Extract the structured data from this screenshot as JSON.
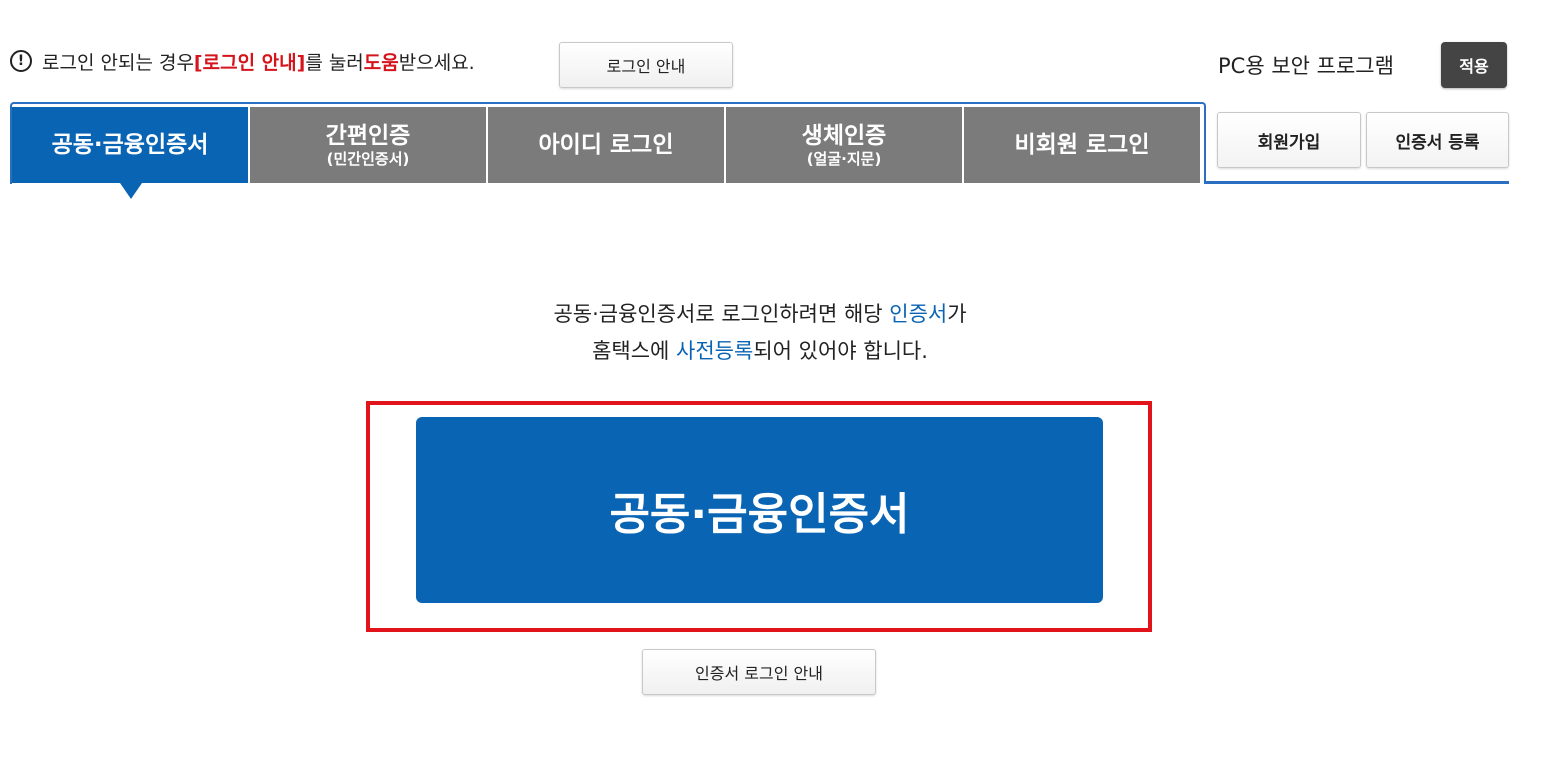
{
  "notice": {
    "icon": "exclamation-circle-icon",
    "text_1": "로그인 안되는 경우 ",
    "highlight_1": "[로그인 안내]",
    "text_2": "를 눌러 ",
    "highlight_2": "도움",
    "text_3": "받으세요.",
    "login_guide_button": "로그인 안내"
  },
  "security": {
    "label": "PC용 보안 프로그램",
    "apply_button": "적용"
  },
  "tabs": [
    {
      "label": "공동·금융인증서",
      "sub": "",
      "active": true
    },
    {
      "label": "간편인증",
      "sub": "(민간인증서)",
      "active": false
    },
    {
      "label": "아이디 로그인",
      "sub": "",
      "active": false
    },
    {
      "label": "생체인증",
      "sub": "(얼굴·지문)",
      "active": false
    },
    {
      "label": "비회원 로그인",
      "sub": "",
      "active": false
    }
  ],
  "side_buttons": {
    "signup": "회원가입",
    "cert_register": "인증서 등록"
  },
  "info": {
    "line1_a": "공동·금융인증서로 로그인하려면 해당 ",
    "line1_b": "인증서",
    "line1_c": "가",
    "line2_a": "홈택스에 ",
    "line2_b": "사전등록",
    "line2_c": "되어 있어야 합니다."
  },
  "main_button": "공동·금융인증서",
  "cert_guide_button": "인증서 로그인 안내",
  "colors": {
    "accent_blue": "#0a64b4",
    "tab_gray": "#7b7b7b",
    "highlight_red": "#d5141c",
    "frame_red": "#e2141b"
  }
}
